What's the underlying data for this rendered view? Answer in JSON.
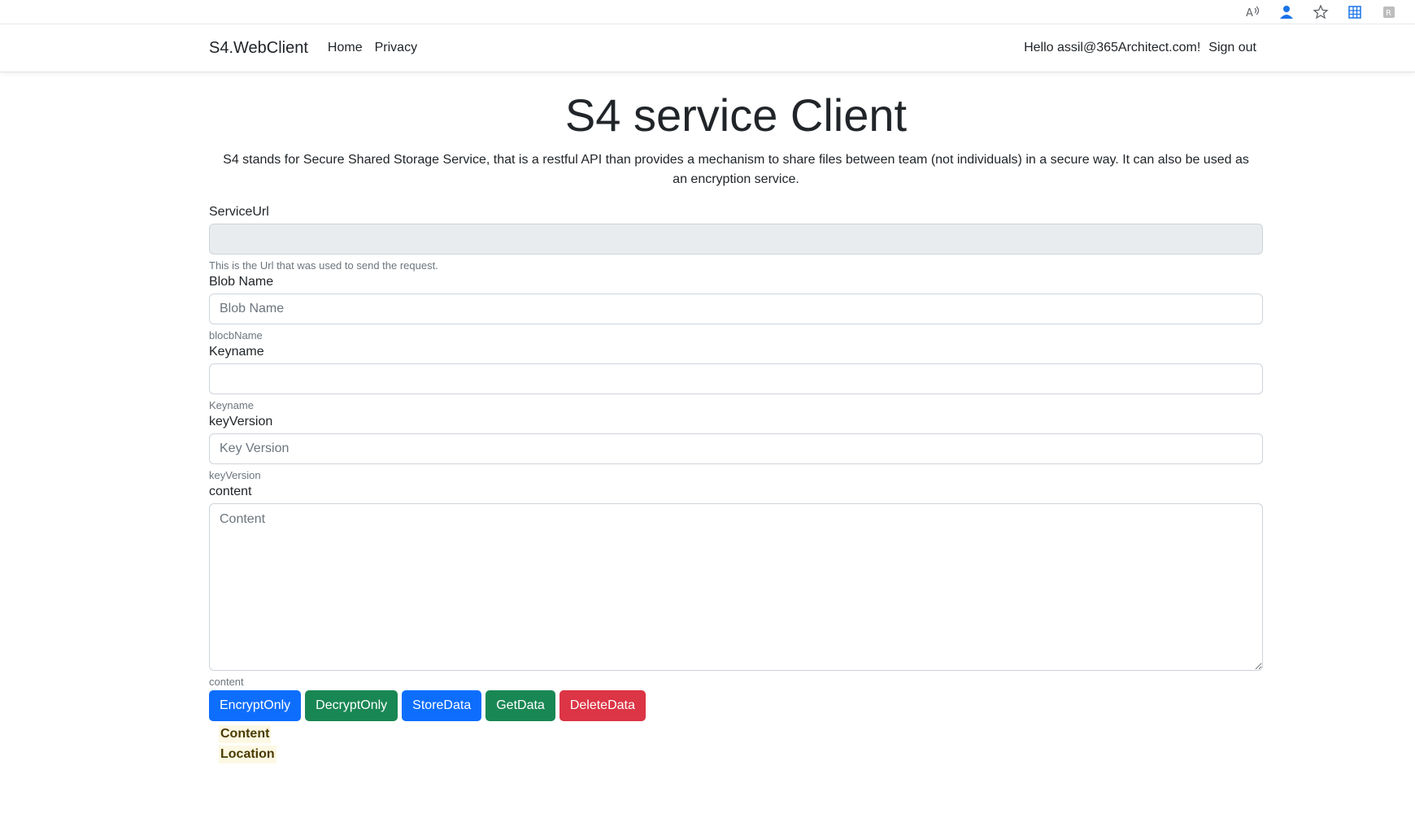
{
  "browser": {
    "icons": [
      "read-aloud-icon",
      "profile-icon",
      "favorite-star-icon",
      "apps-grid-icon",
      "extension-icon"
    ]
  },
  "nav": {
    "brand": "S4.WebClient",
    "links": [
      "Home",
      "Privacy"
    ],
    "greeting": "Hello assil@365Architect.com!",
    "signout": "Sign out"
  },
  "page": {
    "title": "S4 service Client",
    "description": "S4 stands for Secure Shared Storage Service, that is a restful API than provides a mechanism to share files between team (not individuals) in a secure way. It can also be used as an encryption service."
  },
  "form": {
    "serviceUrl": {
      "label": "ServiceUrl",
      "value": "",
      "placeholder": "",
      "help": "This is the Url that was used to send the request."
    },
    "blobName": {
      "label": "Blob Name",
      "value": "",
      "placeholder": "Blob Name",
      "help": "blocbName"
    },
    "keyname": {
      "label": "Keyname",
      "value": "",
      "placeholder": "",
      "help": "Keyname"
    },
    "keyVersion": {
      "label": "keyVersion",
      "value": "",
      "placeholder": "Key Version",
      "help": "keyVersion"
    },
    "content": {
      "label": "content",
      "value": "",
      "placeholder": "Content",
      "help": "content"
    }
  },
  "buttons": {
    "encrypt": "EncryptOnly",
    "decrypt": "DecryptOnly",
    "store": "StoreData",
    "get": "GetData",
    "delete": "DeleteData"
  },
  "colors": {
    "primary": "#0d6efd",
    "success": "#198754",
    "danger": "#dc3545",
    "highlight": "#fcf8e3"
  },
  "results": {
    "content_label": "Content",
    "location_label": "Location"
  }
}
